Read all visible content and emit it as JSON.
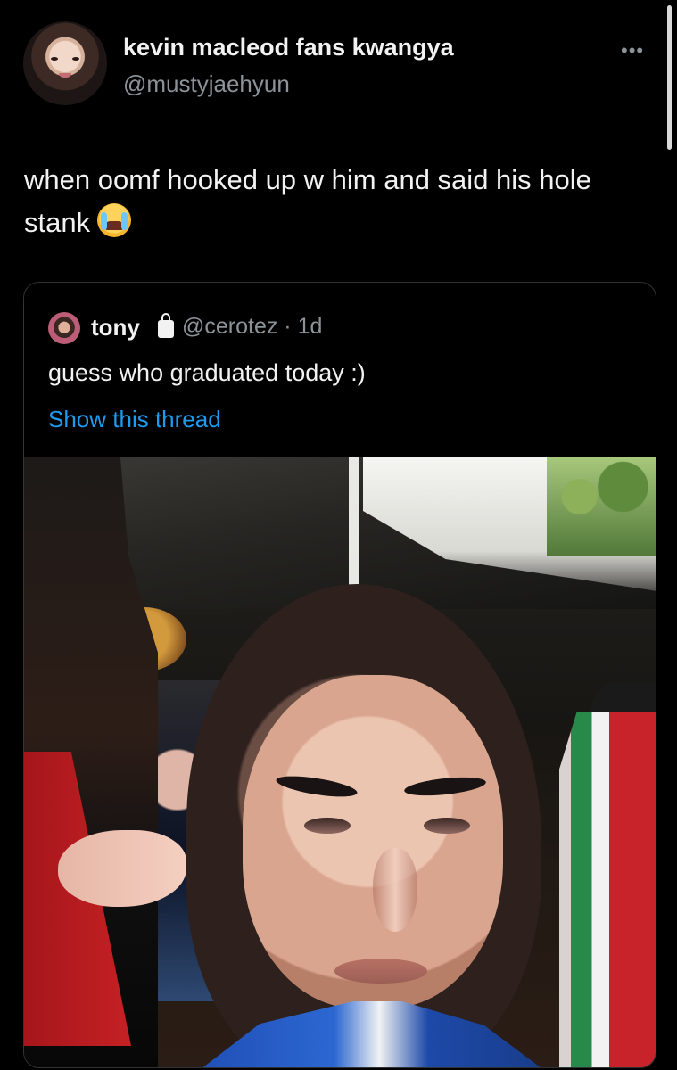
{
  "post": {
    "author": {
      "display_name": "kevin macleod fans kwangya",
      "handle": "@mustyjaehyun"
    },
    "text": "when oomf hooked up w him and said his hole stank",
    "emoji": "loudly-crying-face-icon",
    "more_icon": "more-options-icon"
  },
  "quoted_post": {
    "author": {
      "display_name": "tony",
      "handle_and_time": "@cerotez · 1d"
    },
    "text": "guess who graduated today :)",
    "link": "Show this thread",
    "media": {
      "description_icon": "graduation-selfie-photo"
    }
  },
  "colors": {
    "background": "#000000",
    "text_primary": "#f2f2f2",
    "text_secondary": "#8b9399",
    "link": "#1d9bf0",
    "border": "#2f3336"
  }
}
